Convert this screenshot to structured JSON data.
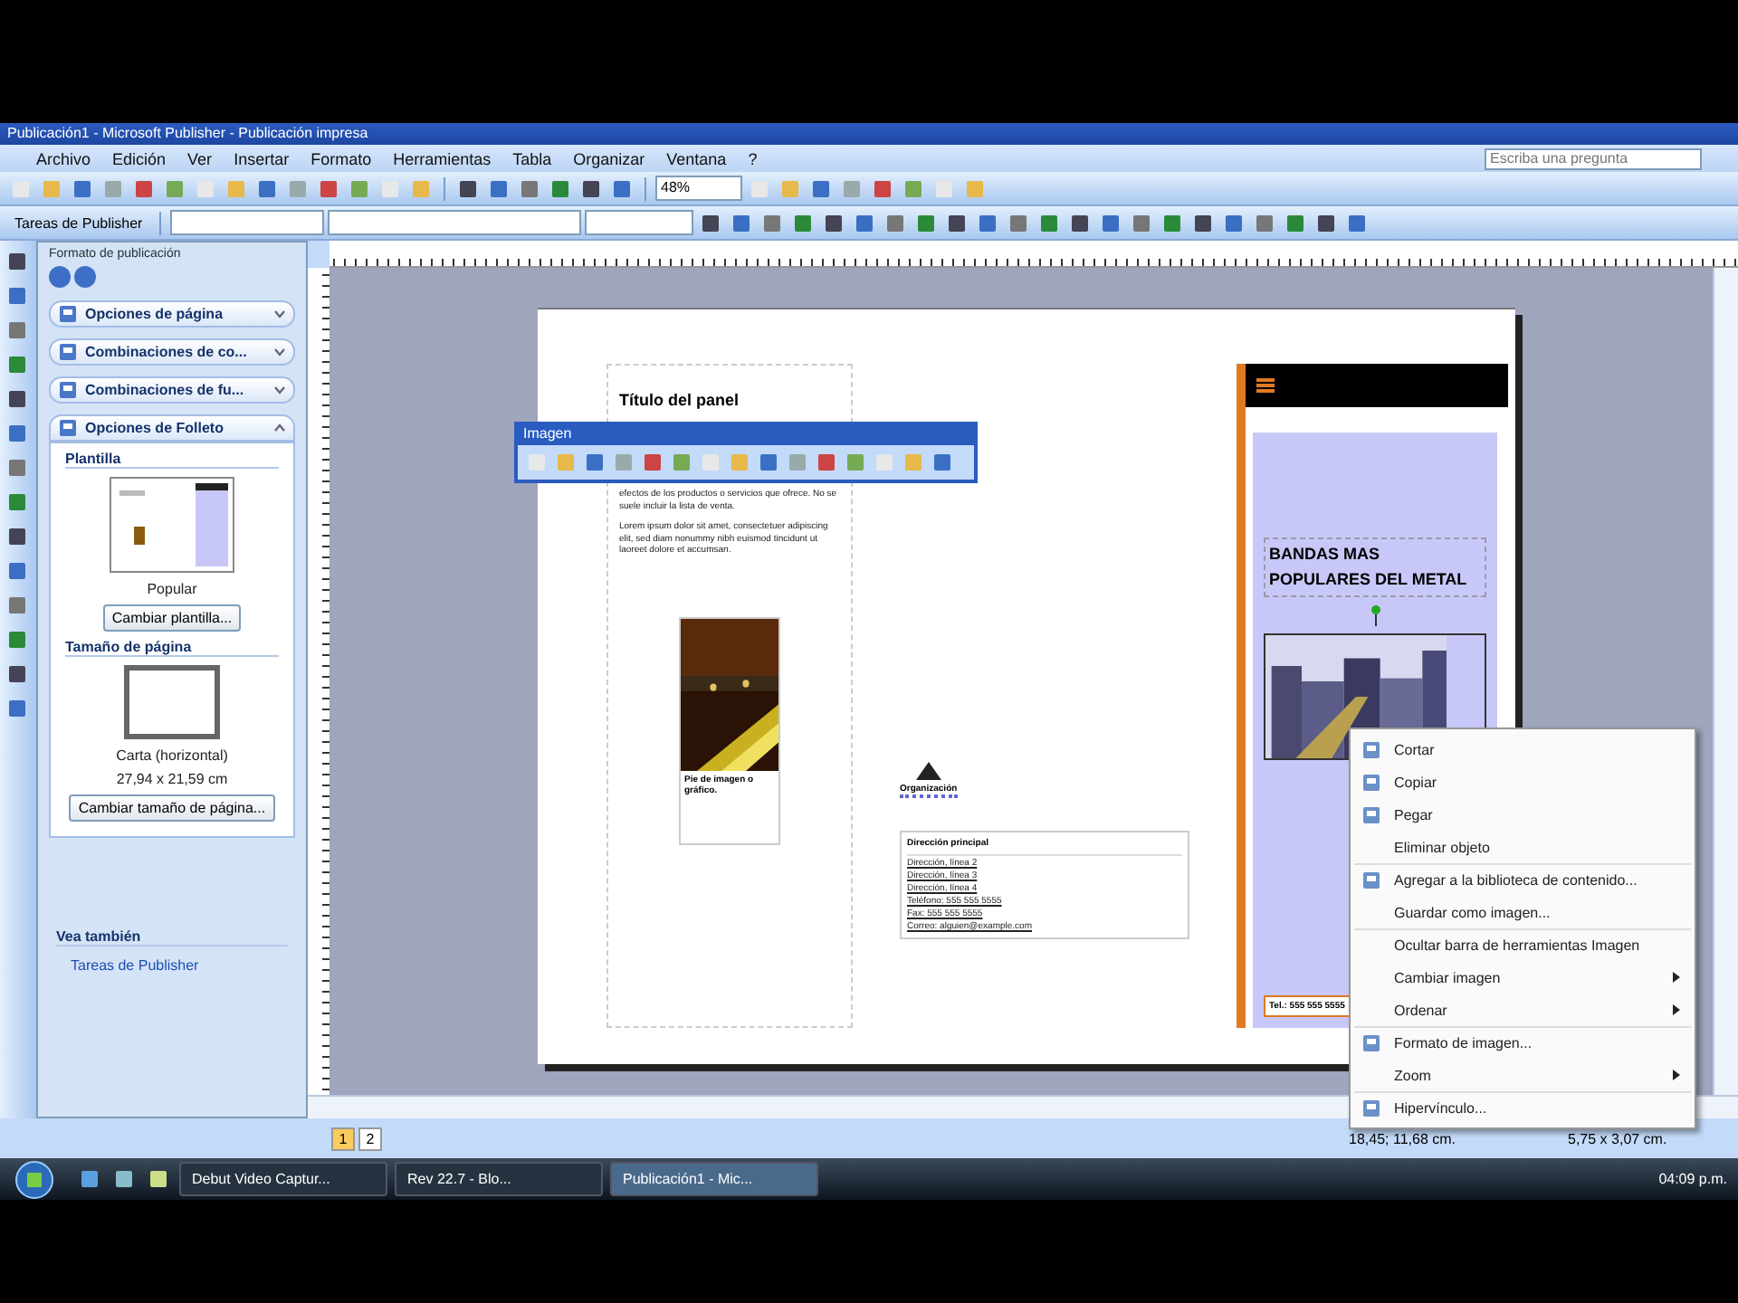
{
  "window": {
    "title": "Publicación1 - Microsoft Publisher - Publicación impresa"
  },
  "menu": [
    "Archivo",
    "Edición",
    "Ver",
    "Insertar",
    "Formato",
    "Herramientas",
    "Tabla",
    "Organizar",
    "Ventana",
    "?"
  ],
  "help_box": {
    "placeholder": "Escriba una pregunta"
  },
  "toolbar": {
    "zoom": "48%",
    "tasks_button": "Tareas de Publisher"
  },
  "task_pane": {
    "title": "Formato de publicación",
    "sections": [
      {
        "label": "Opciones de página",
        "expanded": false
      },
      {
        "label": "Combinaciones de co...",
        "expanded": false
      },
      {
        "label": "Combinaciones de fu...",
        "expanded": false
      },
      {
        "label": "Opciones de Folleto",
        "expanded": true
      }
    ],
    "template_heading": "Plantilla",
    "template_name": "Popular",
    "template_button": "Cambiar plantilla...",
    "size_heading": "Tamaño de página",
    "size_name": "Carta (horizontal)",
    "size_value": "27,94 x 21,59 cm",
    "size_button": "Cambiar tamaño de página...",
    "see_also": "Vea también",
    "see_also_link": "Tareas de Publisher"
  },
  "publication": {
    "panel_1": {
      "title": "Título del panel",
      "paragraphs": [
        "efectos de los productos o servicios que ofrece. No se suele incluir la lista de venta.",
        "Lorem ipsum dolor sit amet, consectetuer adipiscing elit, sed diam nonummy nibh euismod tincidunt ut laoreet dolore et accumsan."
      ],
      "caption": "Pie de imagen o gráfico."
    },
    "panel_2": {
      "logo": "Organización",
      "address_heading": "Dirección principal",
      "address_lines": [
        "Dirección, línea 2",
        "Dirección, línea 3",
        "Dirección, línea 4",
        "Teléfono: 555 555 5555",
        "Fax: 555 555 5555",
        "Correo: alguien@example.com"
      ]
    },
    "panel_3": {
      "title": "BANDAS MAS POPULARES DEL METAL",
      "footer": "Tel.: 555 555 5555"
    }
  },
  "picture_toolbar": {
    "title": "Imagen"
  },
  "context_menu": [
    {
      "label": "Cortar",
      "kind": "icon",
      "submenu": false
    },
    {
      "label": "Copiar",
      "kind": "icon",
      "submenu": false
    },
    {
      "label": "Pegar",
      "kind": "icon",
      "submenu": false
    },
    {
      "label": "Eliminar objeto",
      "kind": "plain",
      "submenu": false
    },
    {
      "label": "Agregar a la biblioteca de contenido...",
      "kind": "icon",
      "submenu": false
    },
    {
      "label": "Guardar como imagen...",
      "kind": "plain",
      "submenu": false
    },
    {
      "label": "Ocultar barra de herramientas Imagen",
      "kind": "plain",
      "submenu": false
    },
    {
      "label": "Cambiar imagen",
      "kind": "plain",
      "submenu": true
    },
    {
      "label": "Ordenar",
      "kind": "plain",
      "submenu": true
    },
    {
      "label": "Formato de imagen...",
      "kind": "icon",
      "submenu": false
    },
    {
      "label": "Zoom",
      "kind": "plain",
      "submenu": true
    },
    {
      "label": "Hipervínculo...",
      "kind": "icon",
      "submenu": false
    }
  ],
  "page_tabs": [
    {
      "label": "1",
      "selected": true
    },
    {
      "label": "2",
      "selected": false
    }
  ],
  "status_bar": {
    "position": "18,45; 11,68 cm.",
    "size": "5,75 x 3,07 cm."
  },
  "taskbar": {
    "tasks": [
      {
        "label": "Debut Video Captur...",
        "selected": false
      },
      {
        "label": "Rev 22.7 - Blo...",
        "selected": false
      },
      {
        "label": "Publicación1 - Mic...",
        "selected": true
      }
    ],
    "clock": "04:09 p.m."
  }
}
